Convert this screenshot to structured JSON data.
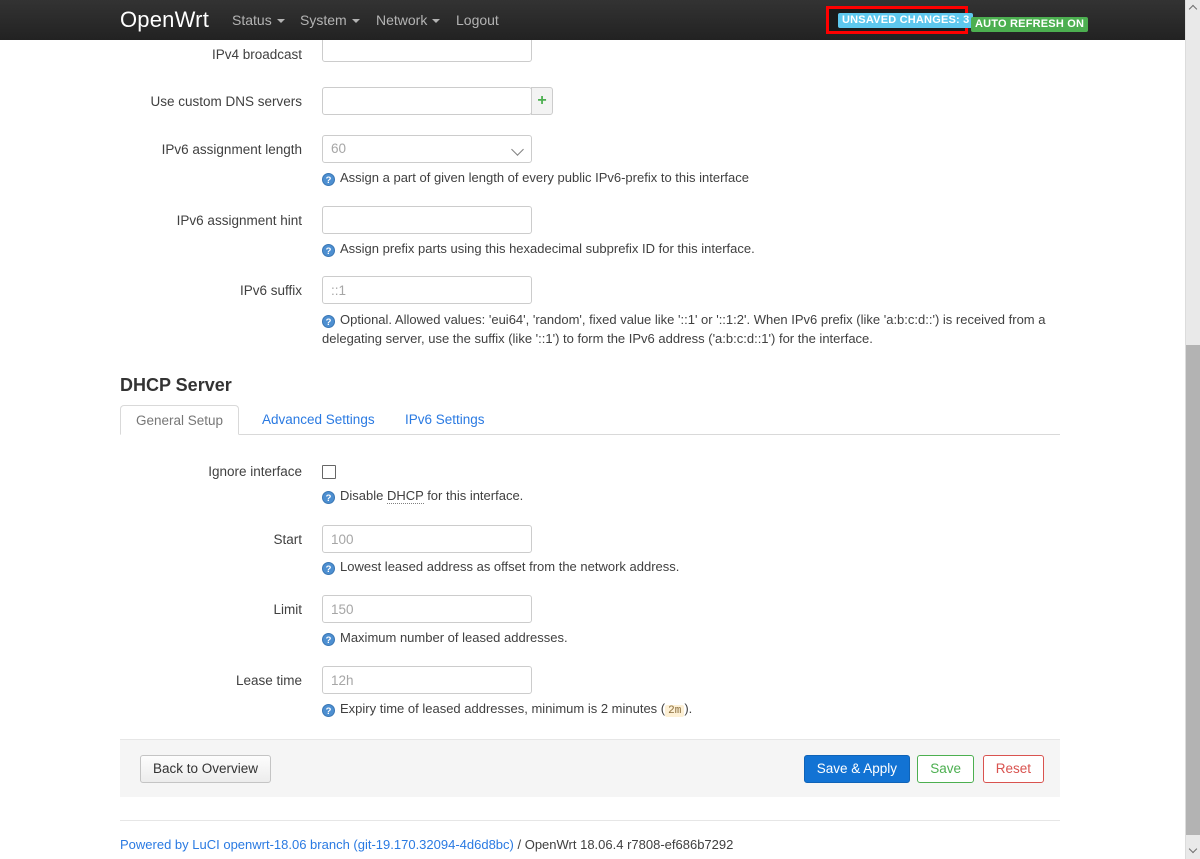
{
  "navbar": {
    "brand": "OpenWrt",
    "menu": [
      {
        "label": "Status",
        "has_caret": true
      },
      {
        "label": "System",
        "has_caret": true
      },
      {
        "label": "Network",
        "has_caret": true
      },
      {
        "label": "Logout",
        "has_caret": false
      }
    ],
    "badges": {
      "unsaved_changes": "UNSAVED CHANGES: 3",
      "auto_refresh": "AUTO REFRESH ON"
    },
    "highlight_color": "#ff0000",
    "unsaved_color": "#5ec8ee",
    "refresh_color": "#4caf50"
  },
  "interface_fields": {
    "ipv4_broadcast": {
      "label": "IPv4 broadcast",
      "value": "",
      "placeholder": ""
    },
    "custom_dns": {
      "label": "Use custom DNS servers",
      "value": "",
      "placeholder": "",
      "add_button": "+"
    },
    "ipv6_assignment_length": {
      "label": "IPv6 assignment length",
      "value": "60",
      "help": "Assign a part of given length of every public IPv6-prefix to this interface"
    },
    "ipv6_assignment_hint": {
      "label": "IPv6 assignment hint",
      "value": "",
      "placeholder": "",
      "help": "Assign prefix parts using this hexadecimal subprefix ID for this interface."
    },
    "ipv6_suffix": {
      "label": "IPv6 suffix",
      "value": "",
      "placeholder": "::1",
      "help": "Optional. Allowed values: 'eui64', 'random', fixed value like '::1' or '::1:2'. When IPv6 prefix (like 'a:b:c:d::') is received from a delegating server, use the suffix (like '::1') to form the IPv6 address ('a:b:c:d::1') for the interface."
    }
  },
  "dhcp": {
    "title": "DHCP Server",
    "tabs": [
      {
        "label": "General Setup",
        "active": true
      },
      {
        "label": "Advanced Settings",
        "active": false
      },
      {
        "label": "IPv6 Settings",
        "active": false
      }
    ],
    "fields": {
      "ignore_interface": {
        "label": "Ignore interface",
        "checked": false,
        "help_before": "Disable ",
        "help_abbr": "DHCP",
        "help_after": " for this interface."
      },
      "start": {
        "label": "Start",
        "value": "",
        "placeholder": "100",
        "help": "Lowest leased address as offset from the network address."
      },
      "limit": {
        "label": "Limit",
        "value": "",
        "placeholder": "150",
        "help": "Maximum number of leased addresses."
      },
      "lease_time": {
        "label": "Lease time",
        "value": "",
        "placeholder": "12h",
        "help_before": "Expiry time of leased addresses, minimum is 2 minutes (",
        "help_code": "2m",
        "help_after": ")."
      }
    }
  },
  "actions": {
    "back": "Back to Overview",
    "save_apply": "Save & Apply",
    "save": "Save",
    "reset": "Reset"
  },
  "footer": {
    "link_text": "Powered by LuCI openwrt-18.06 branch (git-19.170.32094-4d6d8bc)",
    "suffix": " / OpenWrt 18.06.4 r7808-ef686b7292"
  }
}
